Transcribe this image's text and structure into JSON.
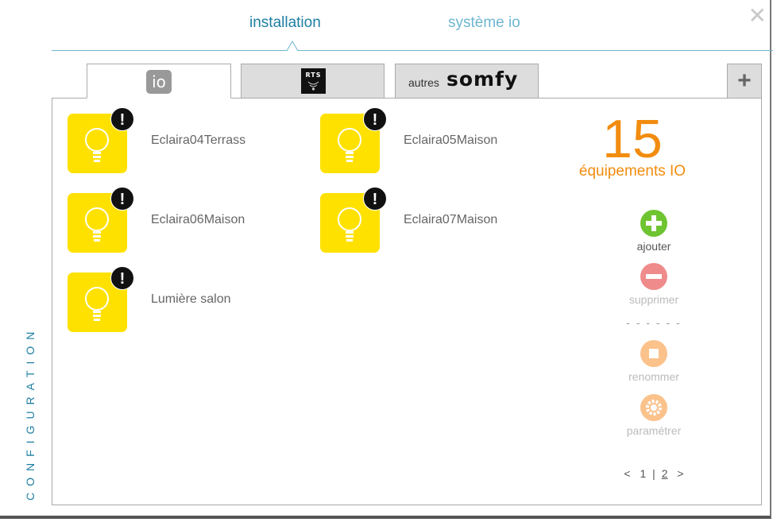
{
  "tabs": {
    "installation": "installation",
    "system": "système io"
  },
  "close_label": "✕",
  "sub_tabs": {
    "io_logo": "io",
    "rts_logo": "RTS",
    "somfy_prefix": "autres",
    "somfy_word": "somfy",
    "add_label": "+"
  },
  "devices": [
    {
      "name": "Eclaira04Terrass",
      "status": "!"
    },
    {
      "name": "Eclaira05Maison",
      "status": "!"
    },
    {
      "name": "Eclaira06Maison",
      "status": "!"
    },
    {
      "name": "Eclaira07Maison",
      "status": "!"
    },
    {
      "name": "Lumière salon",
      "status": "!"
    }
  ],
  "summary": {
    "count": "15",
    "label": "équipements IO"
  },
  "actions": {
    "add": "ajouter",
    "delete": "supprimer",
    "divider": "- - - - - -",
    "rename": "renommer",
    "settings": "paramétrer"
  },
  "pager": {
    "prev": "<",
    "page1": "1",
    "sep": "|",
    "page2": "2",
    "next": ">"
  },
  "side_label": "CONFIGURATION",
  "colors": {
    "accent": "#1d7fa2",
    "orange": "#f28c0f",
    "tile": "#ffe100"
  }
}
